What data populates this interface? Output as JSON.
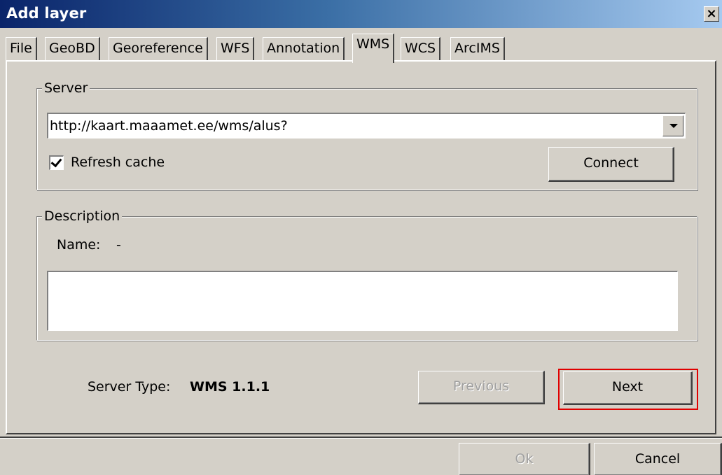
{
  "window": {
    "title": "Add layer",
    "close_label": "×"
  },
  "tabs": [
    {
      "label": "File"
    },
    {
      "label": "GeoBD"
    },
    {
      "label": "Georeference"
    },
    {
      "label": "WFS"
    },
    {
      "label": "Annotation"
    },
    {
      "label": "WMS",
      "active": true
    },
    {
      "label": "WCS"
    },
    {
      "label": "ArcIMS"
    }
  ],
  "server": {
    "group_label": "Server",
    "url_value": "http://kaart.maaamet.ee/wms/alus?",
    "refresh_cache_label": "Refresh cache",
    "refresh_cache_checked": true,
    "connect_label": "Connect"
  },
  "description": {
    "group_label": "Description",
    "name_label": "Name:",
    "name_value": "-",
    "text": ""
  },
  "footer": {
    "server_type_label": "Server Type:",
    "server_type_value": "WMS 1.1.1",
    "previous_label": "Previous",
    "previous_enabled": false,
    "next_label": "Next",
    "highlight_color": "#e00000"
  },
  "dialog_buttons": {
    "ok_label": "Ok",
    "ok_enabled": false,
    "cancel_label": "Cancel"
  },
  "colors": {
    "face": "#d4d0c8",
    "titlebar_start": "#0a246a",
    "titlebar_end": "#a6caf0"
  }
}
